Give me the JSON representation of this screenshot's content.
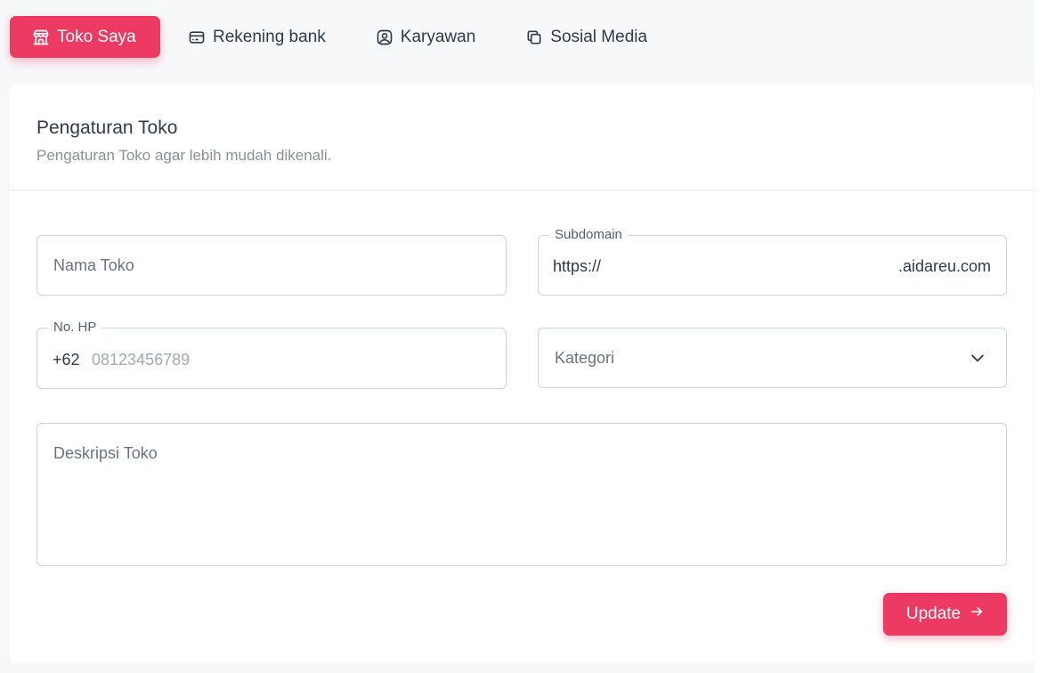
{
  "tabs": [
    {
      "label": "Toko Saya",
      "icon": "store-icon",
      "active": true
    },
    {
      "label": "Rekening bank",
      "icon": "credit-card-icon",
      "active": false
    },
    {
      "label": "Karyawan",
      "icon": "user-circle-icon",
      "active": false
    },
    {
      "label": "Sosial Media",
      "icon": "copy-icon",
      "active": false
    }
  ],
  "card": {
    "title": "Pengaturan Toko",
    "subtitle": "Pengaturan Toko agar lebih mudah dikenali."
  },
  "form": {
    "nama_toko": {
      "placeholder": "Nama Toko",
      "value": ""
    },
    "subdomain": {
      "label": "Subdomain",
      "prefix": "https://",
      "value": "",
      "suffix": ".aidareu.com"
    },
    "no_hp": {
      "label": "No. HP",
      "country_code": "+62",
      "placeholder": "08123456789",
      "value": ""
    },
    "kategori": {
      "placeholder": "Kategori",
      "selected": ""
    },
    "deskripsi": {
      "placeholder": "Deskripsi Toko",
      "value": ""
    }
  },
  "update_button": {
    "label": "Update",
    "icon": "arrow-right-icon"
  },
  "colors": {
    "accent": "#ec3a62",
    "text": "#2f3a4b",
    "muted": "#8a8f98",
    "border": "#cfd3da",
    "background": "#f7f8fa"
  }
}
